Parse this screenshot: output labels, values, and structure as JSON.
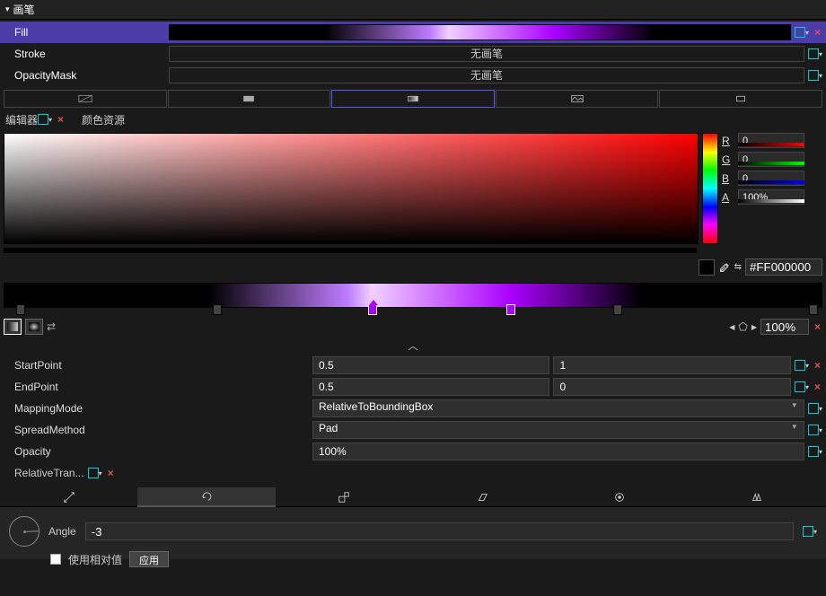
{
  "header": {
    "title": "画笔"
  },
  "brushes": {
    "fill_label": "Fill",
    "stroke_label": "Stroke",
    "stroke_value": "无画笔",
    "opacity_mask_label": "OpacityMask",
    "opacity_mask_value": "无画笔"
  },
  "editor": {
    "label": "编辑器",
    "color_resource_label": "颜色资源"
  },
  "rgba": {
    "r_label": "R",
    "r_value": "0",
    "g_label": "G",
    "g_value": "0",
    "b_label": "B",
    "b_value": "0",
    "a_label": "A",
    "a_value": "100%"
  },
  "hex": {
    "value": "#FF000000"
  },
  "zoom": {
    "value": "100%"
  },
  "props": {
    "start_label": "StartPoint",
    "start_x": "0.5",
    "start_y": "1",
    "end_label": "EndPoint",
    "end_x": "0.5",
    "end_y": "0",
    "mapping_label": "MappingMode",
    "mapping_value": "RelativeToBoundingBox",
    "spread_label": "SpreadMethod",
    "spread_value": "Pad",
    "opacity_label": "Opacity",
    "opacity_value": "100%",
    "reltrans_label": "RelativeTran..."
  },
  "angle": {
    "label": "Angle",
    "value": "-3"
  },
  "bottom": {
    "relative_label": "使用相对值",
    "apply_label": "应用"
  }
}
